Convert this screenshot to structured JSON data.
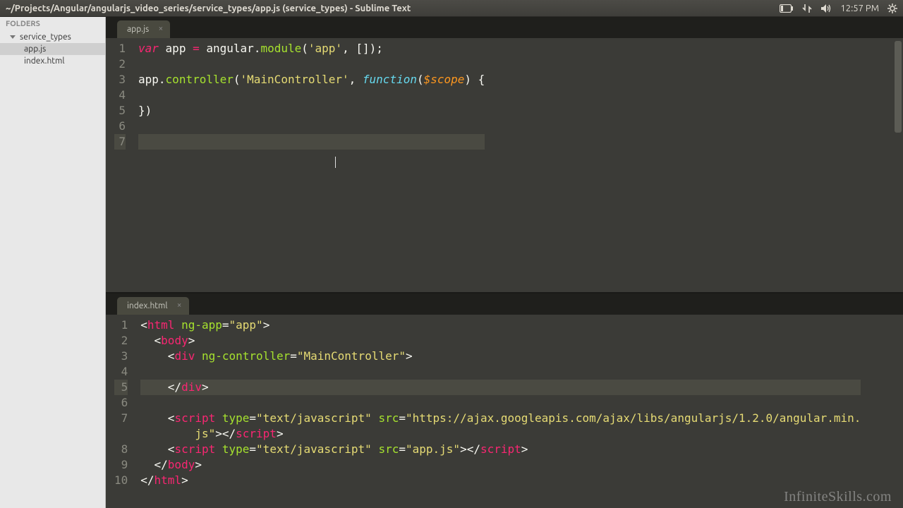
{
  "menubar": {
    "title": "~/Projects/Angular/angularjs_video_series/service_types/app.js (service_types) - Sublime Text",
    "time": "12:57 PM"
  },
  "sidebar": {
    "header": "FOLDERS",
    "folder": "service_types",
    "files": [
      "app.js",
      "index.html"
    ],
    "active_index": 0
  },
  "panes": [
    {
      "tab": "app.js",
      "cursor_line": 7,
      "lines": [
        {
          "hl": false,
          "tokens": [
            [
              "kw",
              "var"
            ],
            [
              "punc",
              " "
            ],
            [
              "ident",
              "app"
            ],
            [
              "punc",
              " "
            ],
            [
              "tag",
              "="
            ],
            [
              "punc",
              " "
            ],
            [
              "ident",
              "angular"
            ],
            [
              "punc",
              "."
            ],
            [
              "func",
              "module"
            ],
            [
              "punc",
              "("
            ],
            [
              "str",
              "'app'"
            ],
            [
              "punc",
              ", []);"
            ]
          ]
        },
        {
          "hl": false,
          "tokens": []
        },
        {
          "hl": false,
          "tokens": [
            [
              "ident",
              "app"
            ],
            [
              "punc",
              "."
            ],
            [
              "func",
              "controller"
            ],
            [
              "punc",
              "("
            ],
            [
              "str",
              "'MainController'"
            ],
            [
              "punc",
              ", "
            ],
            [
              "kw2",
              "function"
            ],
            [
              "punc",
              "("
            ],
            [
              "param",
              "$scope"
            ],
            [
              "punc",
              ") {"
            ]
          ]
        },
        {
          "hl": false,
          "tokens": []
        },
        {
          "hl": false,
          "tokens": [
            [
              "punc",
              "})"
            ]
          ]
        },
        {
          "hl": false,
          "tokens": []
        },
        {
          "hl": true,
          "tokens": []
        }
      ]
    },
    {
      "tab": "index.html",
      "cursor_line": 5,
      "lines": [
        {
          "hl": false,
          "tokens": [
            [
              "punc",
              "<"
            ],
            [
              "tag",
              "html"
            ],
            [
              "punc",
              " "
            ],
            [
              "attr",
              "ng-app"
            ],
            [
              "punc",
              "="
            ],
            [
              "str",
              "\"app\""
            ],
            [
              "punc",
              ">"
            ]
          ]
        },
        {
          "hl": false,
          "tokens": [
            [
              "punc",
              "  <"
            ],
            [
              "tag",
              "body"
            ],
            [
              "punc",
              ">"
            ]
          ]
        },
        {
          "hl": false,
          "tokens": [
            [
              "punc",
              "    <"
            ],
            [
              "tag",
              "div"
            ],
            [
              "punc",
              " "
            ],
            [
              "attr",
              "ng-controller"
            ],
            [
              "punc",
              "="
            ],
            [
              "str",
              "\"MainController\""
            ],
            [
              "punc",
              ">"
            ]
          ]
        },
        {
          "hl": false,
          "tokens": []
        },
        {
          "hl": true,
          "tokens": [
            [
              "punc",
              "    </"
            ],
            [
              "tag",
              "div"
            ],
            [
              "punc",
              ">"
            ]
          ]
        },
        {
          "hl": false,
          "tokens": []
        },
        {
          "hl": false,
          "tokens": [
            [
              "punc",
              "    <"
            ],
            [
              "tag",
              "script"
            ],
            [
              "punc",
              " "
            ],
            [
              "attr",
              "type"
            ],
            [
              "punc",
              "="
            ],
            [
              "str",
              "\"text/javascript\""
            ],
            [
              "punc",
              " "
            ],
            [
              "attr",
              "src"
            ],
            [
              "punc",
              "="
            ],
            [
              "str",
              "\"https://ajax.googleapis.com/ajax/libs/angularjs/1.2.0/angular.min.\n        js\""
            ],
            [
              "punc",
              "></"
            ],
            [
              "tag",
              "script"
            ],
            [
              "punc",
              ">"
            ]
          ]
        },
        {
          "hl": false,
          "tokens": [
            [
              "punc",
              "    <"
            ],
            [
              "tag",
              "script"
            ],
            [
              "punc",
              " "
            ],
            [
              "attr",
              "type"
            ],
            [
              "punc",
              "="
            ],
            [
              "str",
              "\"text/javascript\""
            ],
            [
              "punc",
              " "
            ],
            [
              "attr",
              "src"
            ],
            [
              "punc",
              "="
            ],
            [
              "str",
              "\"app.js\""
            ],
            [
              "punc",
              "></"
            ],
            [
              "tag",
              "script"
            ],
            [
              "punc",
              ">"
            ]
          ]
        },
        {
          "hl": false,
          "tokens": [
            [
              "punc",
              "  </"
            ],
            [
              "tag",
              "body"
            ],
            [
              "punc",
              ">"
            ]
          ]
        },
        {
          "hl": false,
          "tokens": [
            [
              "punc",
              "</"
            ],
            [
              "tag",
              "html"
            ],
            [
              "punc",
              ">"
            ]
          ]
        }
      ]
    }
  ],
  "watermark": "InfiniteSkills.com"
}
